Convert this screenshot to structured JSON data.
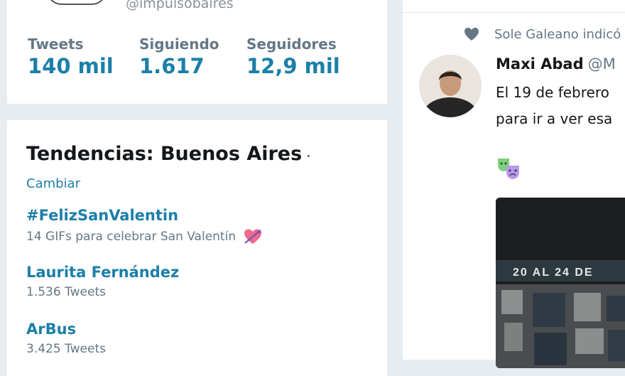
{
  "profile": {
    "handle": "@impulsobaires",
    "stats": [
      {
        "label": "Tweets",
        "value": "140 mil"
      },
      {
        "label": "Siguiendo",
        "value": "1.617"
      },
      {
        "label": "Seguidores",
        "value": "12,9 mil"
      }
    ]
  },
  "trends": {
    "title": "Tendencias: Buenos Aires",
    "separator": "·",
    "change_label": "Cambiar",
    "items": [
      {
        "name": "#FelizSanValentin",
        "subtitle": "14 GIFs para celebrar San Valentín",
        "icon": "heart-arrow-icon"
      },
      {
        "name": "Laurita Fernández",
        "subtitle": "1.536 Tweets"
      },
      {
        "name": "ArBus",
        "subtitle": "3.425 Tweets"
      }
    ]
  },
  "timeline": {
    "context": {
      "icon": "heart-icon",
      "text": "Sole Galeano indicó"
    },
    "tweet": {
      "author_name": "Maxi Abad",
      "author_handle": "@M",
      "lines": [
        "El 19 de febrero",
        "para ir a ver esa"
      ],
      "emoji": "performing-arts-masks-icon",
      "media_text": "20 AL 24 DE"
    }
  },
  "colors": {
    "accent": "#1b7fa8",
    "background": "#e6ecf0",
    "muted": "#657786"
  }
}
